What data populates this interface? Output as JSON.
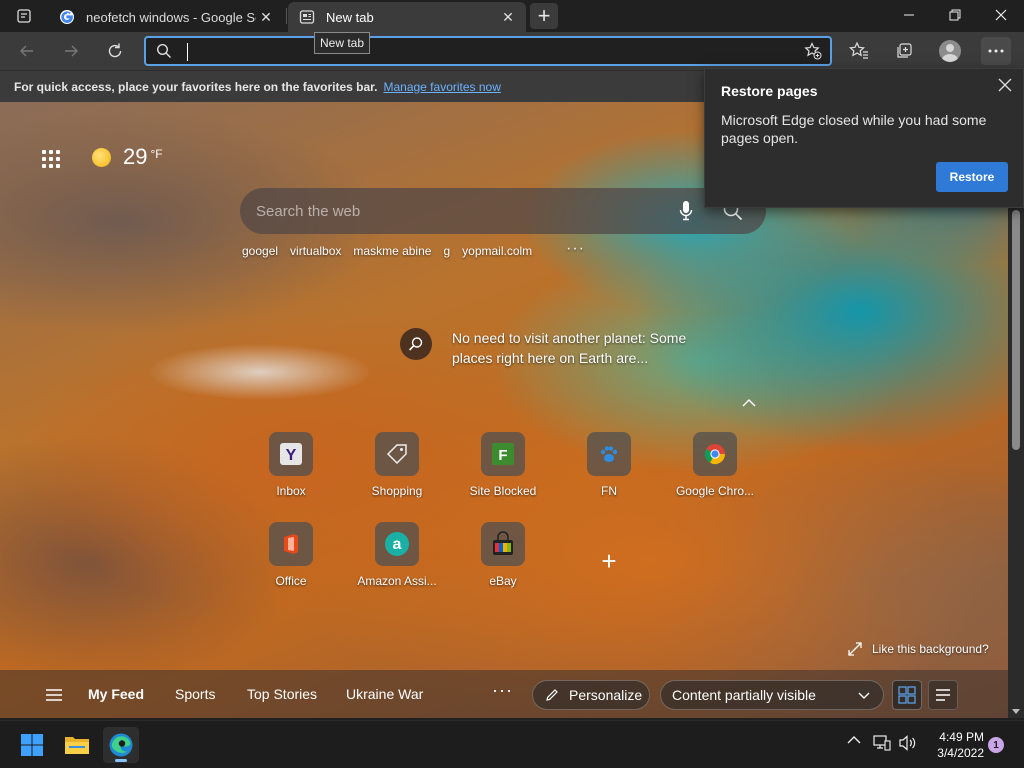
{
  "tabs": [
    {
      "title": "neofetch windows - Google Sear",
      "favicon": "google-icon",
      "active": false
    },
    {
      "title": "New tab",
      "favicon": "new-tab-page-icon",
      "active": true
    }
  ],
  "tooltip": "New tab",
  "address": {
    "value": "",
    "placeholder": ""
  },
  "favorites_bar": {
    "message": "For quick access, place your favorites here on the favorites bar.",
    "link": "Manage favorites now"
  },
  "weather": {
    "temperature": "29",
    "unit": "°F",
    "icon": "sun-icon"
  },
  "search": {
    "placeholder": "Search the web"
  },
  "quick_links": [
    "googel",
    "virtualbox",
    "maskme abine",
    "g",
    "yopmail.colm"
  ],
  "story": {
    "text": "No need to visit another planet: Some places right here on Earth are..."
  },
  "tiles": [
    {
      "label": "Inbox",
      "icon": "yahoo-icon"
    },
    {
      "label": "Shopping",
      "icon": "tag-icon"
    },
    {
      "label": "Site Blocked",
      "icon": "letter-f-icon"
    },
    {
      "label": "FN",
      "icon": "paw-icon"
    },
    {
      "label": "Google Chro...",
      "icon": "chrome-icon"
    },
    {
      "label": "Office",
      "icon": "office-icon"
    },
    {
      "label": "Amazon Assi...",
      "icon": "amazon-icon"
    },
    {
      "label": "eBay",
      "icon": "shopping-bag-icon"
    }
  ],
  "background_link": "Like this background?",
  "feed": {
    "tabs": [
      "My Feed",
      "Sports",
      "Top Stories",
      "Ukraine War"
    ],
    "personalize": "Personalize",
    "content_visibility": "Content partially visible"
  },
  "restore_popup": {
    "title": "Restore pages",
    "body": "Microsoft Edge closed while you had some pages open.",
    "button": "Restore"
  },
  "taskbar": {
    "time": "4:49 PM",
    "date": "3/4/2022",
    "notification_count": "1"
  },
  "colors": {
    "accent": "#2f7ad6",
    "link": "#6cb2ff",
    "address_focus": "#5aa0e6"
  }
}
